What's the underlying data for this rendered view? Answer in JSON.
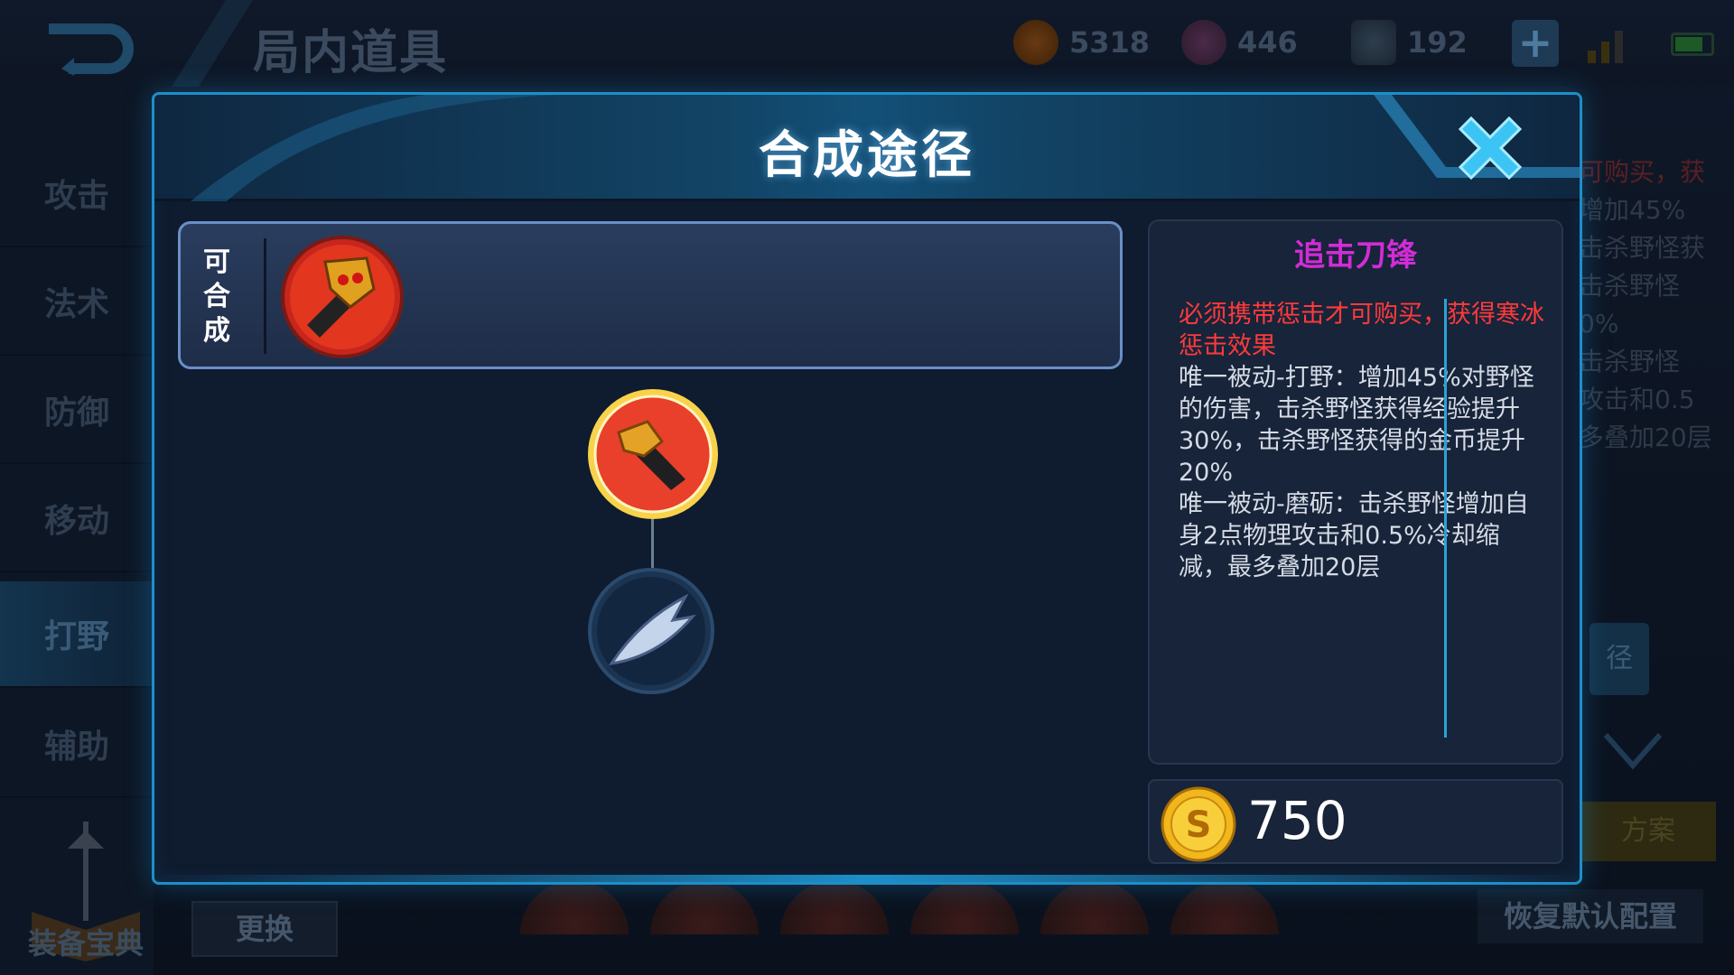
{
  "page": {
    "title": "局内道具",
    "currencies": [
      {
        "name": "gold-icon",
        "value": "5318"
      },
      {
        "name": "diamond-icon",
        "value": "446"
      },
      {
        "name": "voucher-icon",
        "value": "192"
      }
    ],
    "plus_label": "+"
  },
  "sidebar": {
    "items": [
      {
        "label": "攻击"
      },
      {
        "label": "法术"
      },
      {
        "label": "防御"
      },
      {
        "label": "移动"
      },
      {
        "label": "打野",
        "active": true
      },
      {
        "label": "辅助"
      }
    ],
    "codex_label": "装备宝典"
  },
  "bottom": {
    "swap_label": "更换",
    "restore_label": "恢复默认配置"
  },
  "background_panel": {
    "lines": [
      "可购买，获",
      "增加45%",
      "击杀野怪获",
      "击杀野怪",
      "0%",
      "击杀野怪",
      "攻击和0.5",
      "多叠加20层"
    ],
    "path_btn": "径",
    "plan_btn": "方案"
  },
  "modal": {
    "title": "合成途径",
    "combinable_label": [
      "可",
      "合",
      "成"
    ],
    "item": {
      "name": "追击刀锋",
      "requirement": "必须携带惩击才可购买，获得寒冰惩击效果",
      "passive1": "唯一被动-打野：增加45%对野怪的伤害，击杀野怪获得经验提升30%，击杀野怪获得的金币提升20%",
      "passive2": "唯一被动-磨砺：击杀野怪增加自身2点物理攻击和0.5%冷却缩减，最多叠加20层",
      "price": "750"
    }
  },
  "colors": {
    "accent": "#1d8fc8",
    "item_name": "#d22cd6",
    "requirement": "#ff3a3a",
    "gold": "#f2b71c"
  }
}
